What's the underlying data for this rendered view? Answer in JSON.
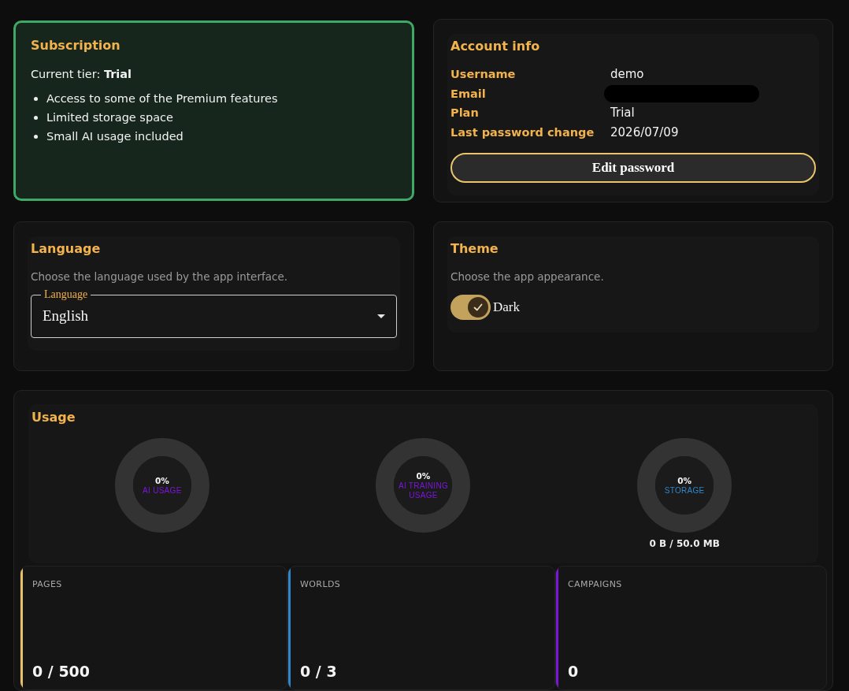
{
  "subscription": {
    "active": true,
    "title": "Subscription",
    "tier_line": "Current tier: **Trial**",
    "features": [
      "Access to some of the Premium features",
      "Limited storage space",
      "Small AI usage included"
    ]
  },
  "account_info": {
    "title": "Account info",
    "rows": [
      {
        "label": "Username",
        "value": "demo"
      },
      {
        "label": "Email",
        "redacted": true
      },
      {
        "label": "Plan",
        "value": "Trial"
      },
      {
        "label": "Last password change",
        "value": "2026/07/09"
      }
    ],
    "button": "Edit password"
  },
  "language": {
    "title": "Language",
    "description": "Choose the language used by the app interface.",
    "field": {
      "label": "Language",
      "value": "English"
    }
  },
  "theme": {
    "title": "Theme",
    "description": "Choose the app appearance.",
    "toggle": {
      "label": "Dark",
      "on": true
    }
  },
  "usage": {
    "title": "Usage",
    "meters": [
      {
        "percent": "0%",
        "label": "AI USAGE",
        "color": "#7b16d9"
      },
      {
        "percent": "0%",
        "label": "AI TRAINING USAGE",
        "color": "#7b16d9"
      },
      {
        "percent": "0%",
        "label": "STORAGE",
        "color": "#2f86c8",
        "caption": "0 B / 50.0 MB"
      }
    ],
    "stats": [
      {
        "label": "PAGES",
        "value": "0 / 500",
        "color": "#e8c06a"
      },
      {
        "label": "WORLDS",
        "value": "0 / 3",
        "color": "#2f86c8"
      },
      {
        "label": "CAMPAIGNS",
        "value": "0",
        "color": "#7b16d9"
      }
    ]
  }
}
